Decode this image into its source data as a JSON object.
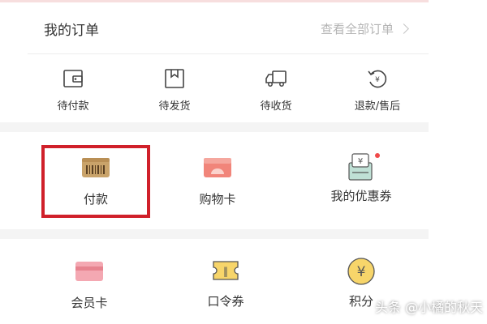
{
  "header": {
    "title": "我的订单",
    "view_all": "查看全部订单"
  },
  "order_status": [
    {
      "label": "待付款",
      "icon": "wallet-icon"
    },
    {
      "label": "待发货",
      "icon": "package-icon"
    },
    {
      "label": "待收货",
      "icon": "delivery-truck-icon"
    },
    {
      "label": "退款/售后",
      "icon": "refund-icon"
    }
  ],
  "grid1": [
    {
      "label": "付款",
      "icon": "payment-barcode-icon"
    },
    {
      "label": "购物卡",
      "icon": "shopping-card-icon"
    },
    {
      "label": "我的优惠券",
      "icon": "coupon-icon",
      "badge": true
    }
  ],
  "grid2": [
    {
      "label": "会员卡",
      "icon": "member-card-icon"
    },
    {
      "label": "口令券",
      "icon": "password-coupon-icon"
    },
    {
      "label": "积分",
      "icon": "points-yuan-icon"
    }
  ],
  "watermark": "头条 @小橘的秋天",
  "colors": {
    "highlight": "#d0202a",
    "badge": "#f04a4a",
    "card_tan": "#c9a36a",
    "card_salmon": "#f1857a",
    "card_pink": "#f4a8b2",
    "coin_yellow": "#f7d56a"
  }
}
